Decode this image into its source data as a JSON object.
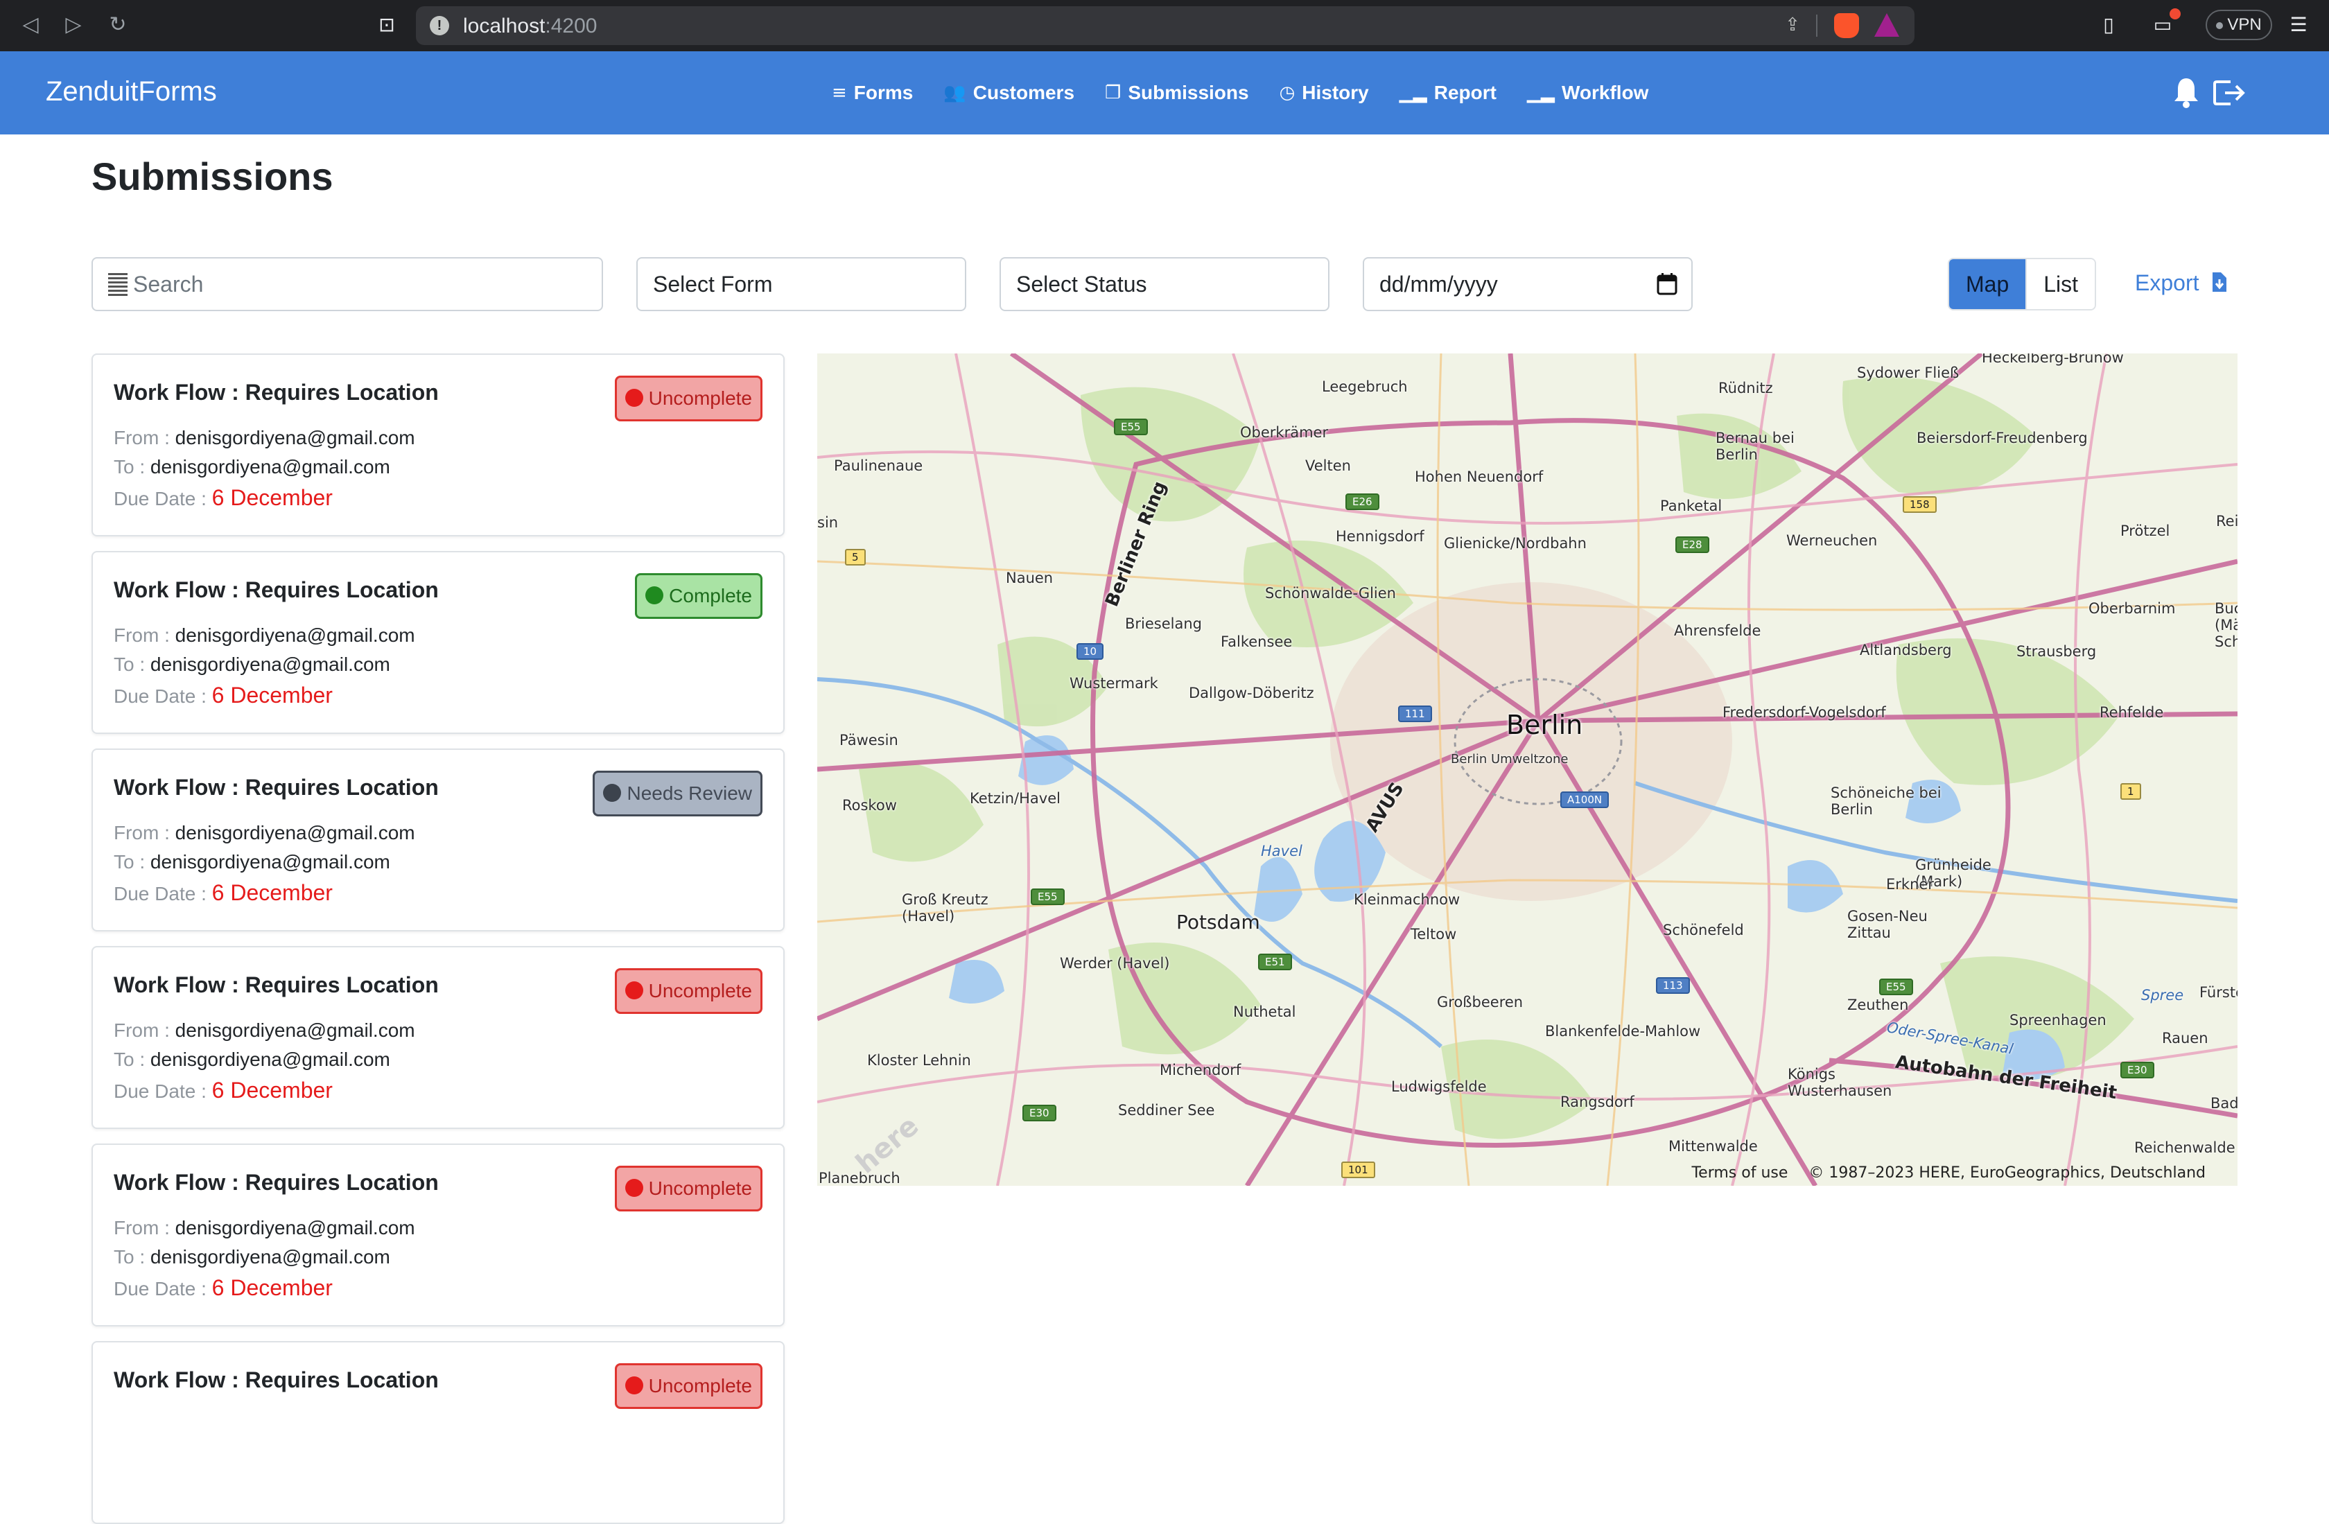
{
  "browser": {
    "url_host": "localhost",
    "url_port": ":4200",
    "vpn_label": "VPN"
  },
  "app": {
    "brand": "ZenduitForms",
    "nav": [
      {
        "label": "Forms",
        "icon": "list-icon"
      },
      {
        "label": "Customers",
        "icon": "users-icon"
      },
      {
        "label": "Submissions",
        "icon": "copy-icon"
      },
      {
        "label": "History",
        "icon": "clock-icon"
      },
      {
        "label": "Report",
        "icon": "chart-icon"
      },
      {
        "label": "Workflow",
        "icon": "chart-icon"
      }
    ]
  },
  "page": {
    "title": "Submissions"
  },
  "filters": {
    "search_placeholder": "Search",
    "form_placeholder": "Select Form",
    "status_placeholder": "Select Status",
    "date_placeholder": "dd/mm/yyyy"
  },
  "view_toggle": {
    "map": "Map",
    "list": "List",
    "active": "Map"
  },
  "export_label": "Export",
  "labels": {
    "from": "From :",
    "to": "To :",
    "due": "Due Date :"
  },
  "submissions": [
    {
      "title": "Work Flow : Requires Location",
      "status": "Uncomplete",
      "from": "denisgordiyena@gmail.com",
      "to": "denisgordiyena@gmail.com",
      "due": "6 December"
    },
    {
      "title": "Work Flow : Requires Location",
      "status": "Complete",
      "from": "denisgordiyena@gmail.com",
      "to": "denisgordiyena@gmail.com",
      "due": "6 December"
    },
    {
      "title": "Work Flow : Requires Location",
      "status": "Needs Review",
      "from": "denisgordiyena@gmail.com",
      "to": "denisgordiyena@gmail.com",
      "due": "6 December"
    },
    {
      "title": "Work Flow : Requires Location",
      "status": "Uncomplete",
      "from": "denisgordiyena@gmail.com",
      "to": "denisgordiyena@gmail.com",
      "due": "6 December"
    },
    {
      "title": "Work Flow : Requires Location",
      "status": "Uncomplete",
      "from": "denisgordiyena@gmail.com",
      "to": "denisgordiyena@gmail.com",
      "due": "6 December"
    },
    {
      "title": "Work Flow : Requires Location",
      "status": "Uncomplete",
      "from": "",
      "to": "",
      "due": ""
    }
  ],
  "status_colors": {
    "Uncomplete": "#e51b1b",
    "Complete": "#1f8a1f",
    "Needs Review": "#3c434d"
  },
  "map": {
    "main_city": "Berlin",
    "zone_label": "Berlin Umweltzone",
    "towns": [
      "Potsdam"
    ],
    "places": [
      "Heckelberg-Brunow",
      "Sydower Fließ",
      "Rüdnitz",
      "Leegebruch",
      "Oberkrämer",
      "Bernau bei Berlin",
      "Beiersdorf-Freudenberg",
      "Paulinenaue",
      "Velten",
      "Hohen Neuendorf",
      "Panketal",
      "Hennigsdorf",
      "Glienicke/Nordbahn",
      "Werneuchen",
      "Prötzel",
      "Nauen",
      "Schönwalde-Glien",
      "Oberbarnim",
      "Brieselang",
      "Falkensee",
      "Ahrensfelde",
      "Altlandsberg",
      "Strausberg",
      "Wustermark",
      "Dallgow-Döberitz",
      "Fredersdorf-Vogelsdorf",
      "Rehfelde",
      "Päwesin",
      "Roskow",
      "Ketzin/Havel",
      "Schöneiche bei Berlin",
      "Havel",
      "Grünheide (Mark)",
      "Groß Kreutz (Havel)",
      "Kleinmachnow",
      "Erkner",
      "Teltow",
      "Schönefeld",
      "Gosen-Neu Zittau",
      "Werder (Havel)",
      "Nuthetal",
      "Großbeeren",
      "Zeuthen",
      "Spree",
      "Spreenhagen",
      "Blankenfelde-Mahlow",
      "Kloster Lehnin",
      "Michendorf",
      "Ludwigsfelde",
      "Königs Wusterhausen",
      "Rauen",
      "Seddiner See",
      "Rangsdorf",
      "Mittenwalde",
      "Reichenwalde",
      "Planebruch",
      "Oder-Spree-Kanal",
      "Fürste",
      "Rei",
      "Buc (Mä Sch",
      "Bad S",
      "sin"
    ],
    "roads": [
      "Berliner Ring",
      "AVUS",
      "Autobahn der Freiheit"
    ],
    "shields": [
      "E55",
      "E26",
      "E28",
      "158",
      "5",
      "10",
      "111",
      "A100N",
      "1",
      "E55",
      "E51",
      "113",
      "E55",
      "E30",
      "E30",
      "101"
    ],
    "attribution_terms": "Terms of use",
    "attribution": "© 1987–2023 HERE, EuroGeographics, Deutschland",
    "watermark": "here"
  }
}
